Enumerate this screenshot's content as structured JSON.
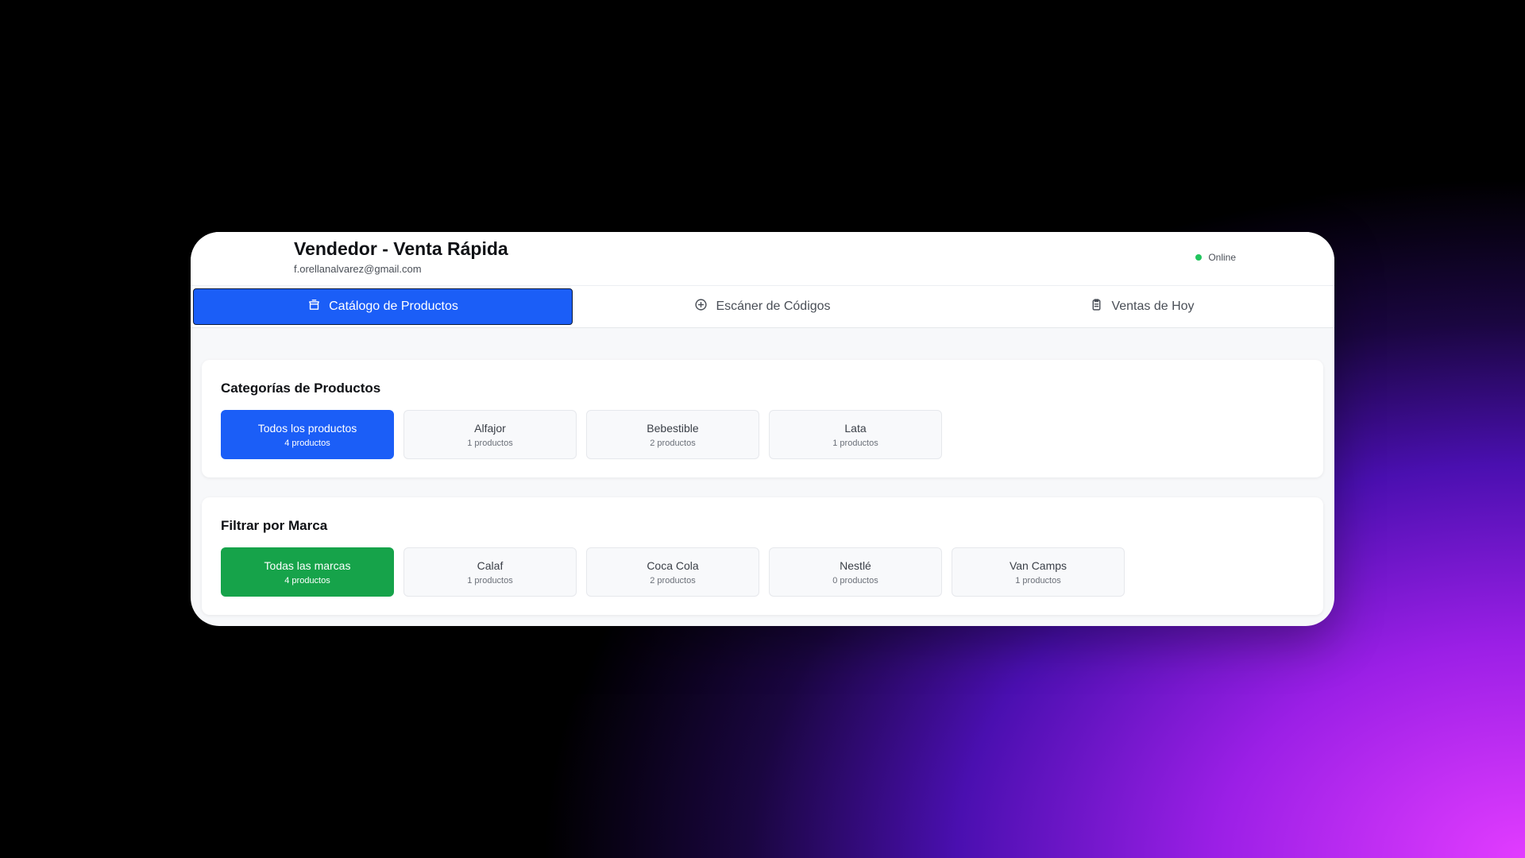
{
  "header": {
    "title": "Vendedor - Venta Rápida",
    "email": "f.orellanalvarez@gmail.com",
    "status": "Online",
    "status_color": "#22c55e"
  },
  "tabs": [
    {
      "label": "Catálogo de Productos",
      "icon": "store-icon",
      "active": true
    },
    {
      "label": "Escáner de Códigos",
      "icon": "scan-icon",
      "active": false
    },
    {
      "label": "Ventas de Hoy",
      "icon": "clipboard-icon",
      "active": false
    }
  ],
  "categories": {
    "title": "Categorías de Productos",
    "items": [
      {
        "name": "Todos los productos",
        "count": "4 productos",
        "active": true
      },
      {
        "name": "Alfajor",
        "count": "1 productos",
        "active": false
      },
      {
        "name": "Bebestible",
        "count": "2 productos",
        "active": false
      },
      {
        "name": "Lata",
        "count": "1 productos",
        "active": false
      }
    ]
  },
  "brands": {
    "title": "Filtrar por Marca",
    "items": [
      {
        "name": "Todas las marcas",
        "count": "4 productos",
        "active": true
      },
      {
        "name": "Calaf",
        "count": "1 productos",
        "active": false
      },
      {
        "name": "Coca Cola",
        "count": "2 productos",
        "active": false
      },
      {
        "name": "Nestlé",
        "count": "0 productos",
        "active": false
      },
      {
        "name": "Van Camps",
        "count": "1 productos",
        "active": false
      }
    ]
  },
  "colors": {
    "primary": "#1b5ef7",
    "success": "#16a34a"
  }
}
